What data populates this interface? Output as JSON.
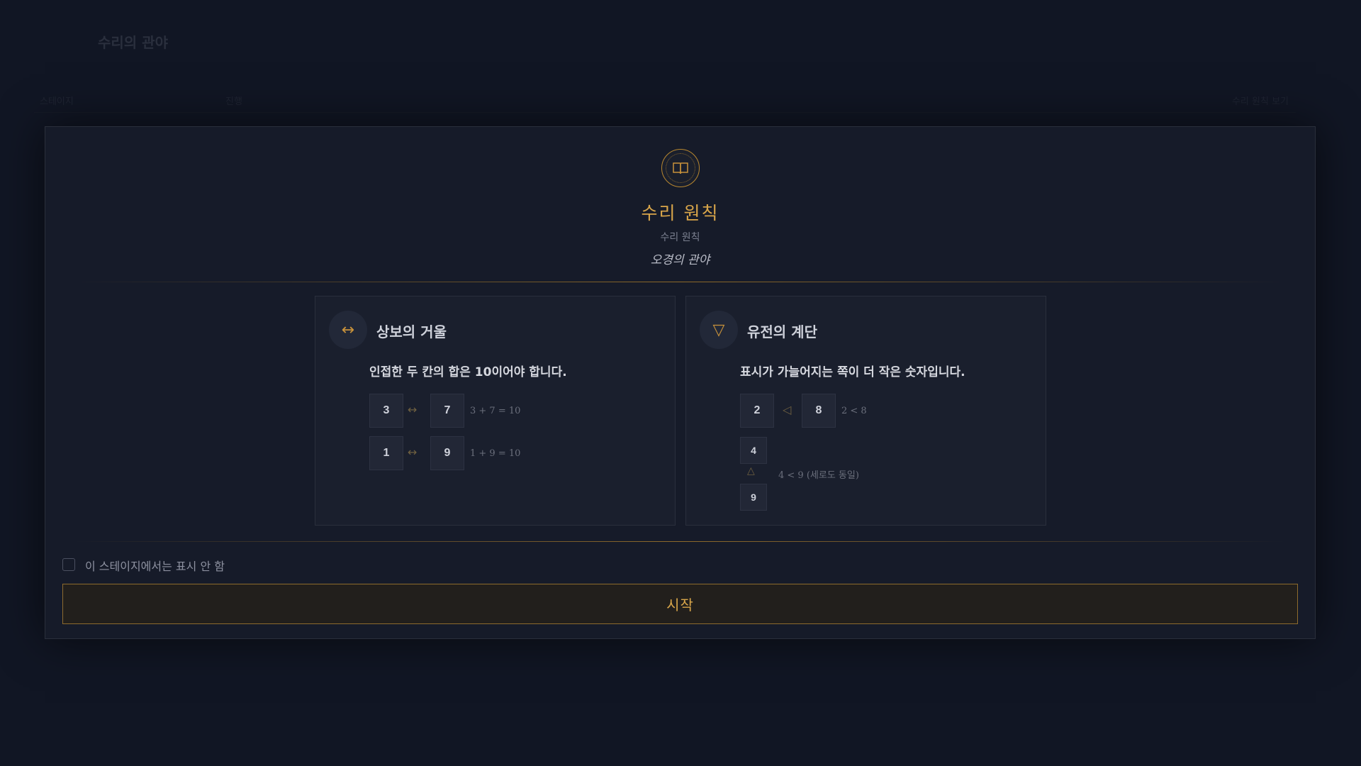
{
  "modal": {
    "emblem_icon": "book-icon",
    "title": "수리 원칙",
    "subtitle": "수리 원칙",
    "tagline": "오경의 관야",
    "accent_color": "#d9a64a"
  },
  "cards": [
    {
      "icon": "arrows-horizontal-icon",
      "icon_glyph": "↔",
      "title": "상보의 거울",
      "description": "인접한 두 칸의 합은 10이어야 합니다.",
      "examples": [
        {
          "a": "3",
          "b": "7",
          "note": "3 + 7 = 10"
        },
        {
          "a": "1",
          "b": "9",
          "note": "1 + 9 = 10"
        }
      ],
      "separator": "↔"
    },
    {
      "icon": "triangle-down-icon",
      "icon_glyph": "▽",
      "title": "유전의 계단",
      "description": "표시가 가늘어지는 쪽이 더 작은 숫자입니다.",
      "horizontal_example": {
        "a": "2",
        "b": "8",
        "note": "2 < 8",
        "separator": "◁"
      },
      "vertical_example": {
        "top": "4",
        "bottom": "9",
        "note": "4 < 9 (세로도 동일)",
        "separator": "△"
      }
    }
  ],
  "footer": {
    "checkbox_label": "이 스테이지에서는 표시 안 함",
    "checkbox_checked": false,
    "start_label": "시작"
  },
  "background": {
    "title": "수리의 관야",
    "subtitle": "",
    "bar_left": "스테이지",
    "bar_mid": "진행",
    "bar_right": "수리 원칙 보기"
  }
}
